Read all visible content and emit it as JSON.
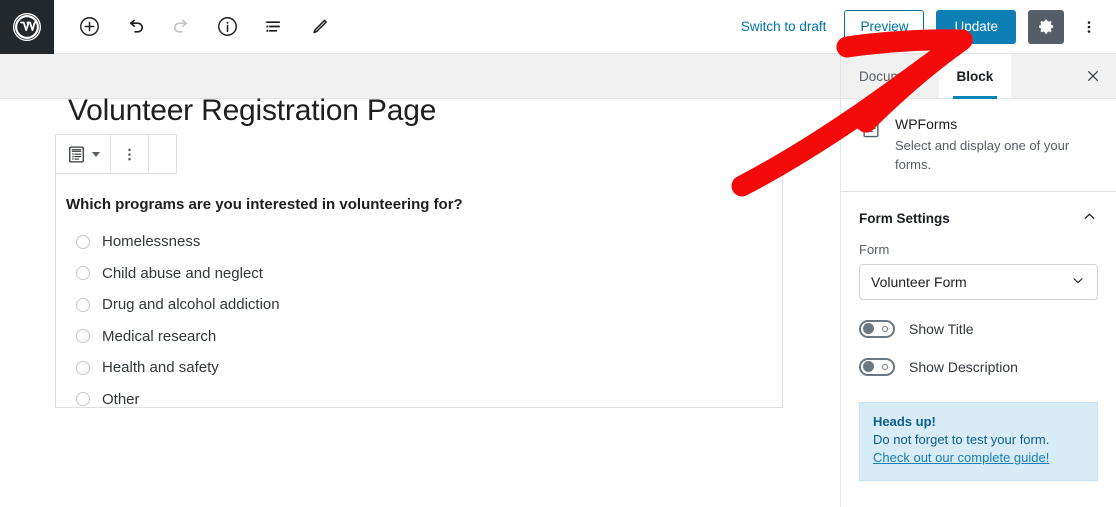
{
  "toolbar": {
    "logo_icon": "wordpress-logo-icon",
    "add_block_label": "Add block",
    "undo_label": "Undo",
    "redo_label": "Redo",
    "info_label": "Details",
    "list_view_label": "List view",
    "edit_label": "Edit",
    "switch_to_draft": "Switch to draft",
    "preview": "Preview",
    "update": "Update",
    "settings_label": "Settings",
    "more_label": "Options"
  },
  "editor": {
    "post_title": "Volunteer Registration Page",
    "block_toolbar": {
      "block_type_label": "WPForms block",
      "more_options_label": "More options"
    },
    "form": {
      "question": "Which programs are you interested in volunteering for?",
      "options": [
        "Homelessness",
        "Child abuse and neglect",
        "Drug and alcohol addiction",
        "Medical research",
        "Health and safety",
        "Other"
      ]
    }
  },
  "sidebar": {
    "tabs": [
      {
        "label": "Document",
        "active": false
      },
      {
        "label": "Block",
        "active": true
      }
    ],
    "close_label": "×",
    "block_info": {
      "title": "WPForms",
      "description": "Select and display one of your forms."
    },
    "section": {
      "title": "Form Settings",
      "collapse_label": "Collapse"
    },
    "form_field": {
      "label": "Form",
      "value": "Volunteer Form"
    },
    "toggles": [
      {
        "label": "Show Title",
        "on": false
      },
      {
        "label": "Show Description",
        "on": false
      }
    ],
    "notice": {
      "title": "Heads up!",
      "text": "Do not forget to test your form.",
      "link": "Check out our complete guide!"
    }
  },
  "annotation": {
    "arrow_color": "#f50a0a",
    "arrow_target": "update-button"
  },
  "colors": {
    "wp_blue": "#0e7fb5",
    "link_blue": "#0073aa",
    "tab_accent": "#0085ba",
    "gear_bg": "#555d66",
    "notice_bg": "#d7ecf7",
    "arrow_red": "#f50a0a"
  }
}
